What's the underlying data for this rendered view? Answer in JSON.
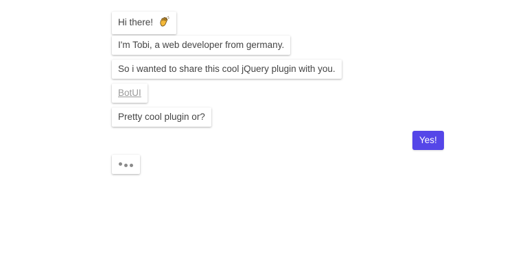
{
  "messages": [
    {
      "from": "bot",
      "text": "Hi there!",
      "icon": "waving-hand-icon"
    },
    {
      "from": "bot",
      "text": "I'm Tobi, a web developer from germany."
    },
    {
      "from": "bot",
      "text": "So i wanted to share this cool jQuery plugin with you."
    },
    {
      "from": "bot",
      "text": "BotUI",
      "type": "link"
    },
    {
      "from": "bot",
      "text": "Pretty cool plugin or?"
    },
    {
      "from": "human",
      "text": "Yes!"
    }
  ],
  "typing_indicator": {
    "visible": true
  },
  "colors": {
    "human_bubble": "#5546e8",
    "bot_text": "#444444",
    "link": "#999999"
  }
}
